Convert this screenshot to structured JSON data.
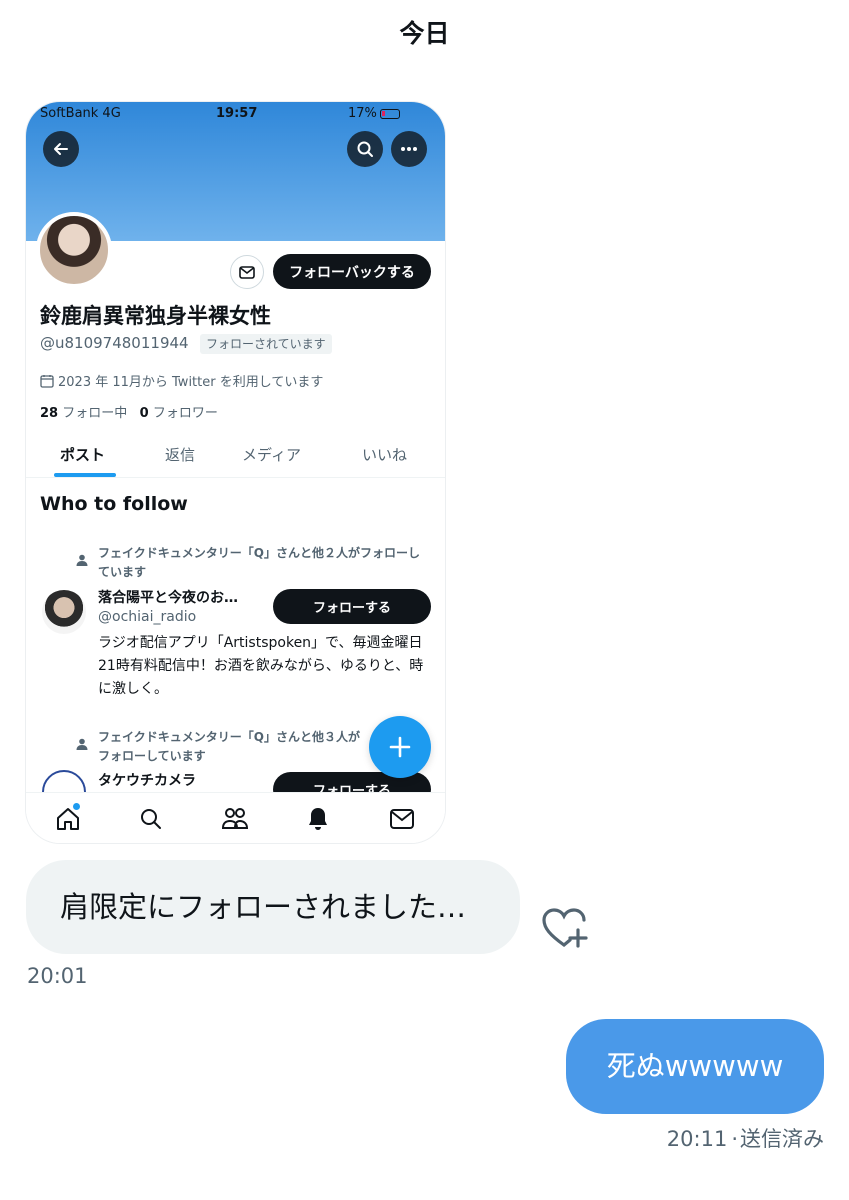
{
  "date_header": "今日",
  "screenshot": {
    "status": {
      "carrier": "SoftBank  4G",
      "time": "19:57",
      "battery": "17%"
    },
    "profile": {
      "follow_back_label": "フォローバックする",
      "display_name": "鈴鹿肩異常独身半裸女性",
      "handle": "@u8109748011944",
      "followed_badge": "フォローされています",
      "joined": "2023 年 11月から Twitter を利用しています",
      "following_count": "28",
      "following_label": "フォロー中",
      "followers_count": "0",
      "followers_label": "フォロワー"
    },
    "tabs": [
      "ポスト",
      "返信",
      "メディア",
      "いいね"
    ],
    "who_to_follow": {
      "title": "Who to follow",
      "users": [
        {
          "context": "フェイクドキュメンタリー「Q」さんと他２人がフォローしています",
          "name": "落合陽平と今夜のお…",
          "handle": "@ochiai_radio",
          "follow_label": "フォローする",
          "bio": "ラジオ配信アプリ「Artistspoken」で、毎週金曜日21時有料配信中！お酒を飲みながら、ゆるりと、時に激しく。"
        },
        {
          "context": "フェイクドキュメンタリー「Q」さんと他３人がフォローしています",
          "name": "タケウチカメラ",
          "follow_label": "フォローする"
        }
      ]
    }
  },
  "messages": [
    {
      "direction": "incoming",
      "text": "肩限定にフォローされました…",
      "time": "20:01"
    },
    {
      "direction": "outgoing",
      "text": "死ぬwwwww",
      "time": "20:11",
      "status": "送信済み"
    }
  ],
  "colors": {
    "accent": "#1d9bf0",
    "outgoing_bubble": "#4a99e9",
    "incoming_bubble": "#eff3f4"
  }
}
